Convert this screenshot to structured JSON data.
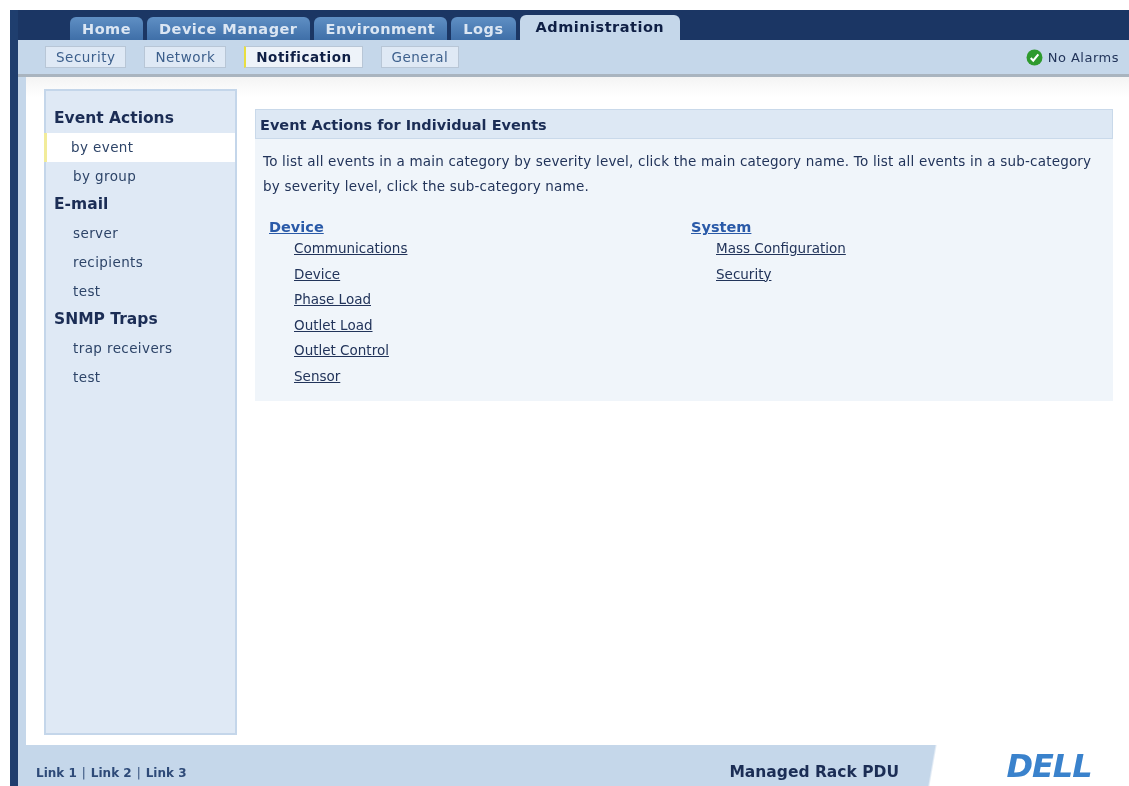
{
  "tabs": [
    {
      "label": "Home",
      "selected": false
    },
    {
      "label": "Device Manager",
      "selected": false
    },
    {
      "label": "Environment",
      "selected": false
    },
    {
      "label": "Logs",
      "selected": false
    },
    {
      "label": "Administration",
      "selected": true
    }
  ],
  "subtabs": [
    {
      "label": "Security",
      "selected": false
    },
    {
      "label": "Network",
      "selected": false
    },
    {
      "label": "Notification",
      "selected": true
    },
    {
      "label": "General",
      "selected": false
    }
  ],
  "alarm_status": {
    "label": "No Alarms"
  },
  "sidebar": {
    "sections": [
      {
        "title": "Event Actions",
        "items": [
          {
            "label": "by event",
            "selected": true
          },
          {
            "label": "by group",
            "selected": false
          }
        ]
      },
      {
        "title": "E-mail",
        "items": [
          {
            "label": "server",
            "selected": false
          },
          {
            "label": "recipients",
            "selected": false
          },
          {
            "label": "test",
            "selected": false
          }
        ]
      },
      {
        "title": "SNMP Traps",
        "items": [
          {
            "label": "trap receivers",
            "selected": false
          },
          {
            "label": "test",
            "selected": false
          }
        ]
      }
    ]
  },
  "panel": {
    "title": "Event Actions for Individual Events",
    "description": "To list all events in a main category by severity level, click the main category name. To list all events in a sub-category by severity level, click the sub-category name.",
    "categories": [
      {
        "name": "Device",
        "subcategories": [
          "Communications",
          "Device",
          "Phase Load",
          "Outlet Load",
          "Outlet Control",
          "Sensor"
        ]
      },
      {
        "name": "System",
        "subcategories": [
          "Mass Configuration",
          "Security"
        ]
      }
    ]
  },
  "footer": {
    "links": [
      "Link 1",
      "Link 2",
      "Link 3"
    ],
    "separator": "|",
    "product": "Managed Rack PDU",
    "logo": "DELL"
  }
}
